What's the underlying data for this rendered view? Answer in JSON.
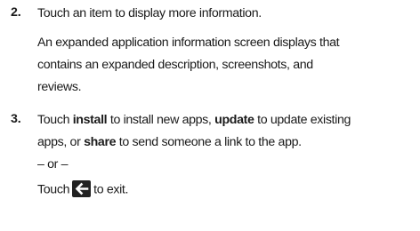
{
  "steps": [
    {
      "number": "2.",
      "lines": [
        "Touch an item to display more information.",
        "An expanded application information screen displays that",
        "contains an expanded description, screenshots, and",
        "reviews."
      ]
    },
    {
      "number": "3.",
      "line1": {
        "a": "Touch ",
        "b_install": "install",
        "c": " to install new apps, ",
        "d_update": "update",
        "e": " to update existing"
      },
      "line2": {
        "a": "apps, or ",
        "b_share": "share",
        "c": " to send someone a link to the app."
      },
      "or_text": "– or –",
      "line4": {
        "a": "Touch",
        "icon": "back-arrow-icon",
        "b": "to exit."
      }
    }
  ]
}
